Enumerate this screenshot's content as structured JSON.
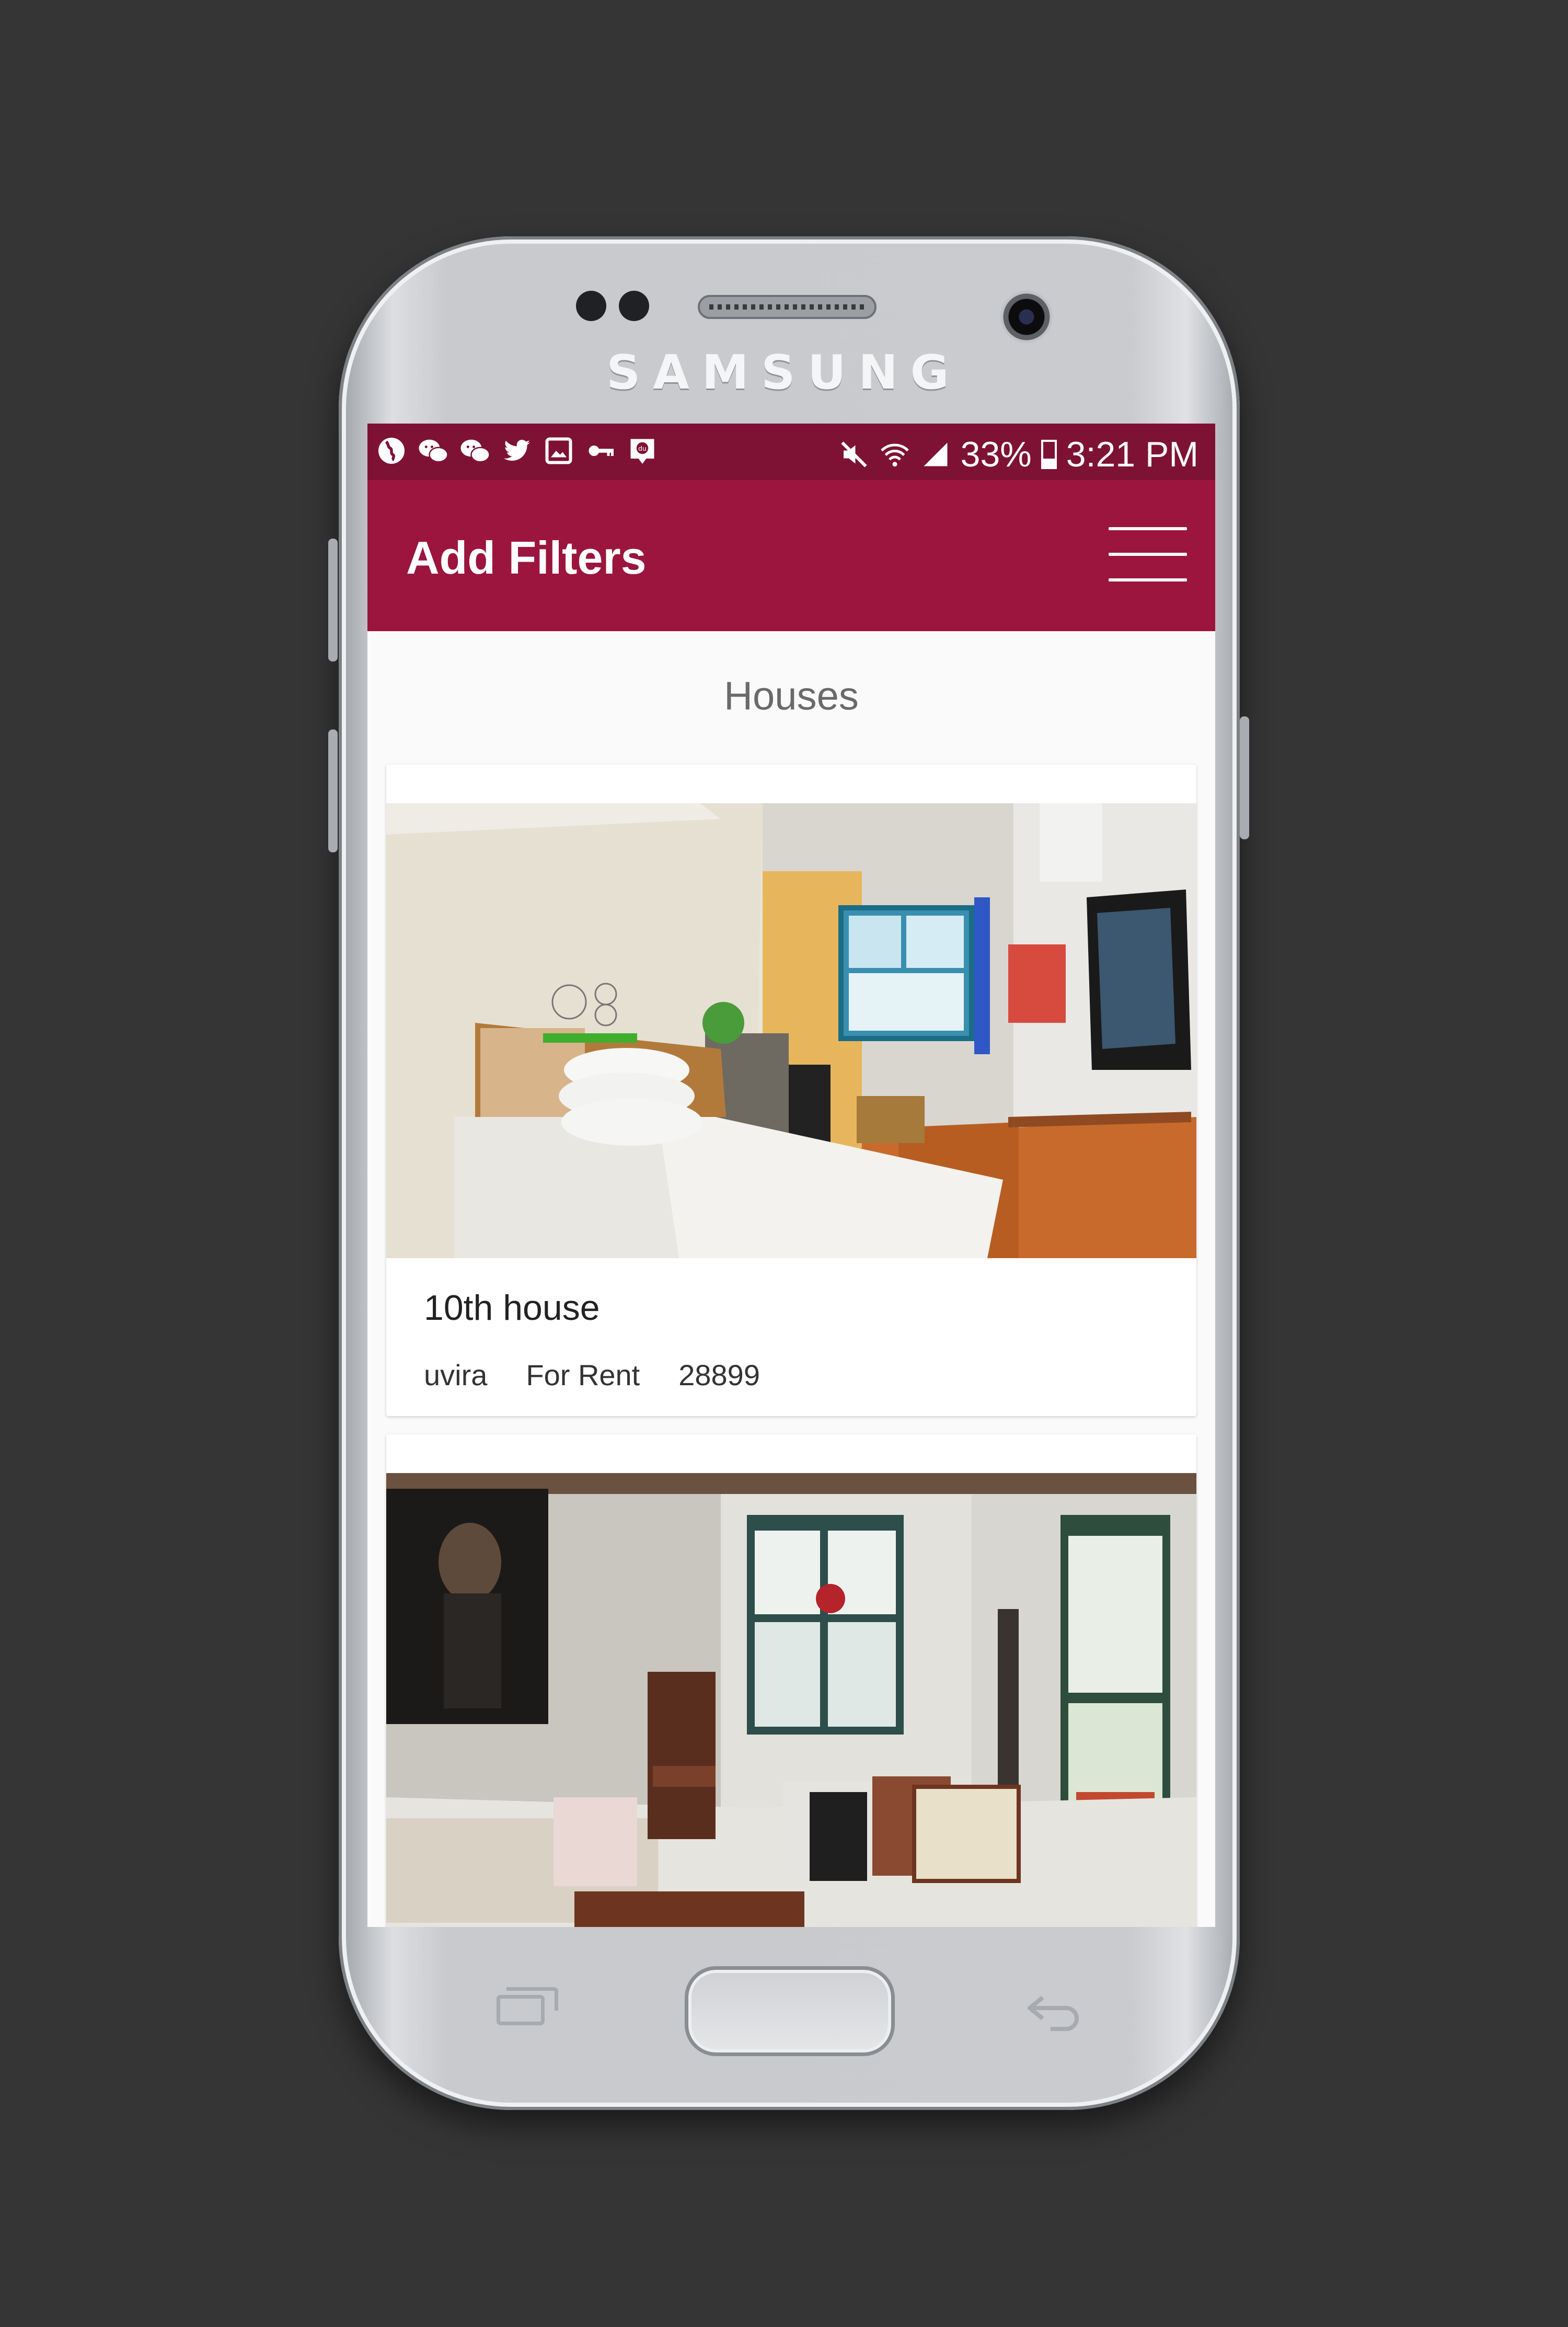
{
  "device": {
    "brand": "SAMSUNG"
  },
  "status_bar": {
    "notification_icons": [
      "globe-icon",
      "wechat-icon",
      "wechat-icon",
      "twitter-icon",
      "image-icon",
      "key-icon",
      "du-icon"
    ],
    "mute_icon": "mute-icon",
    "wifi_icon": "wifi-icon",
    "signal_icon": "signal-icon",
    "battery_percent": "33%",
    "battery_icon": "battery-icon",
    "time": "3:21 PM"
  },
  "app_bar": {
    "title": "Add Filters",
    "menu_icon": "hamburger-menu-icon",
    "color": "#9b153f"
  },
  "section": {
    "title": "Houses"
  },
  "listings": [
    {
      "name": "10th house",
      "location": "uvira",
      "status": "For Rent",
      "price": "28899",
      "photo": "bedroom"
    },
    {
      "photo": "living-room"
    }
  ],
  "colors": {
    "status_bar": "#7e1235",
    "app_bar": "#9b153f",
    "background": "#fafafa"
  }
}
